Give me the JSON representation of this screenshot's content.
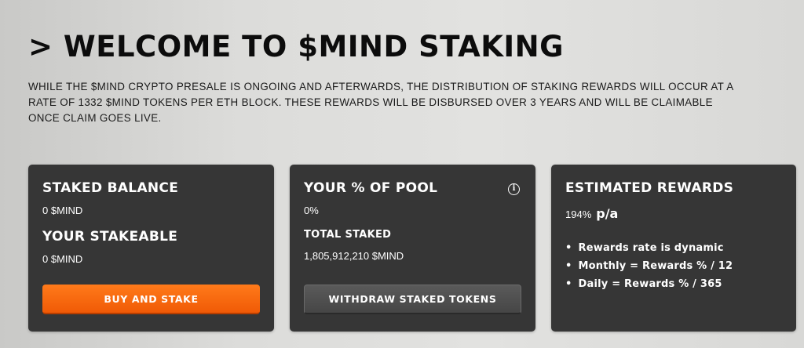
{
  "header": {
    "title": "> WELCOME TO $MIND STAKING",
    "description": "WHILE THE $MIND CRYPTO PRESALE IS ONGOING AND AFTERWARDS, THE DISTRIBUTION OF STAKING REWARDS WILL OCCUR AT A RATE OF 1332 $MIND TOKENS PER ETH BLOCK. THESE REWARDS WILL BE DISBURSED OVER 3 YEARS AND WILL BE CLAIMABLE ONCE CLAIM GOES LIVE."
  },
  "cards": {
    "staked": {
      "title": "STAKED BALANCE",
      "balance": "0  $MIND",
      "stakeable_title": "YOUR STAKEABLE",
      "stakeable_value": "0  $MIND",
      "button_label": "BUY AND STAKE"
    },
    "pool": {
      "title": "YOUR % OF POOL",
      "percent": "0%",
      "info_icon": "i",
      "total_title": "TOTAL STAKED",
      "total_value": "1,805,912,210  $MIND",
      "button_label": "WITHDRAW STAKED TOKENS"
    },
    "rewards": {
      "title": "ESTIMATED REWARDS",
      "rate": "194%",
      "rate_unit": "p/a",
      "bullets": [
        "Rewards rate is dynamic",
        "Monthly = Rewards % / 12",
        "Daily = Rewards % / 365"
      ]
    }
  },
  "colors": {
    "accent_orange": "#f56b0e",
    "card_bg": "#363636",
    "page_bg": "#dcdcda"
  }
}
